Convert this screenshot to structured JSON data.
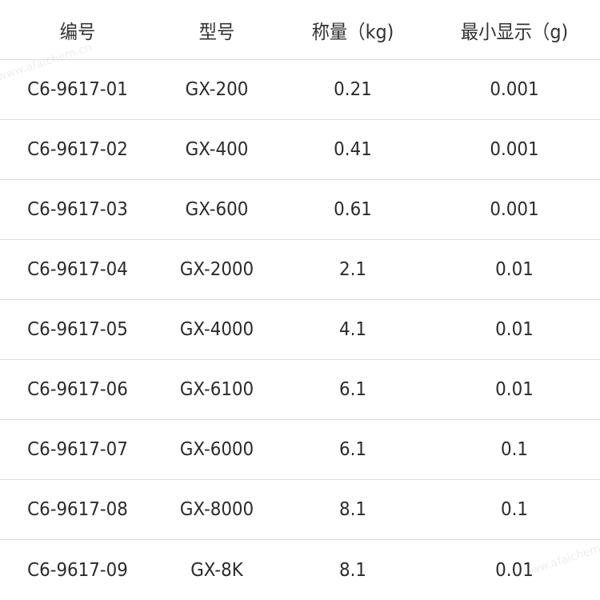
{
  "table": {
    "headers": [
      "编号",
      "型号",
      "称量（kg)",
      "最小显示（g)"
    ],
    "rows": [
      [
        "C6-9617-01",
        "GX-200",
        "0.21",
        "0.001"
      ],
      [
        "C6-9617-02",
        "GX-400",
        "0.41",
        "0.001"
      ],
      [
        "C6-9617-03",
        "GX-600",
        "0.61",
        "0.001"
      ],
      [
        "C6-9617-04",
        "GX-2000",
        "2.1",
        "0.01"
      ],
      [
        "C6-9617-05",
        "GX-4000",
        "4.1",
        "0.01"
      ],
      [
        "C6-9617-06",
        "GX-6100",
        "6.1",
        "0.01"
      ],
      [
        "C6-9617-07",
        "GX-6000",
        "6.1",
        "0.1"
      ],
      [
        "C6-9617-08",
        "GX-8000",
        "8.1",
        "0.1"
      ],
      [
        "C6-9617-09",
        "GX-8K",
        "8.1",
        "0.01"
      ]
    ]
  },
  "watermarks": [
    "www.afaichem.cn",
    "www.afaichem.cn"
  ]
}
